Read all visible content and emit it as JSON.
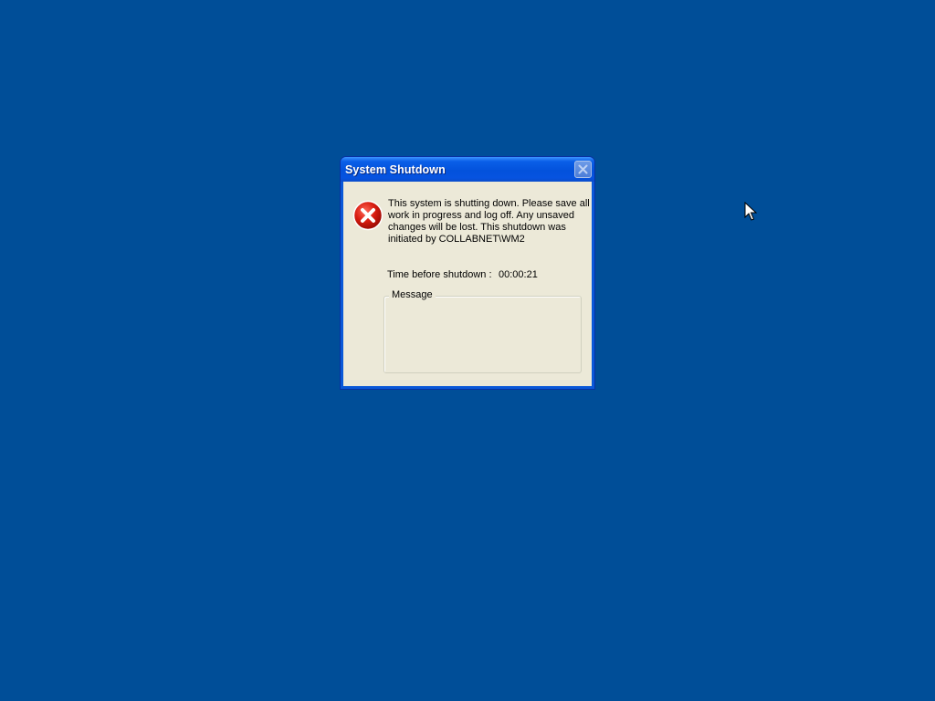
{
  "dialog": {
    "title": "System Shutdown",
    "message": "This system is shutting down. Please save all work in progress and log off. Any unsaved changes will be lost. This shutdown was initiated by COLLABNET\\WM2",
    "time_label": "Time before shutdown :",
    "time_value": "00:00:21",
    "message_group_label": "Message",
    "message_content": ""
  },
  "icons": {
    "error": "error-icon",
    "close": "close-icon",
    "cursor": "mouse-pointer-icon"
  },
  "colors": {
    "desktop": "#004e98",
    "dialog_face": "#ece9d8",
    "titlebar": "#0352dc",
    "error_red": "#d82020"
  }
}
